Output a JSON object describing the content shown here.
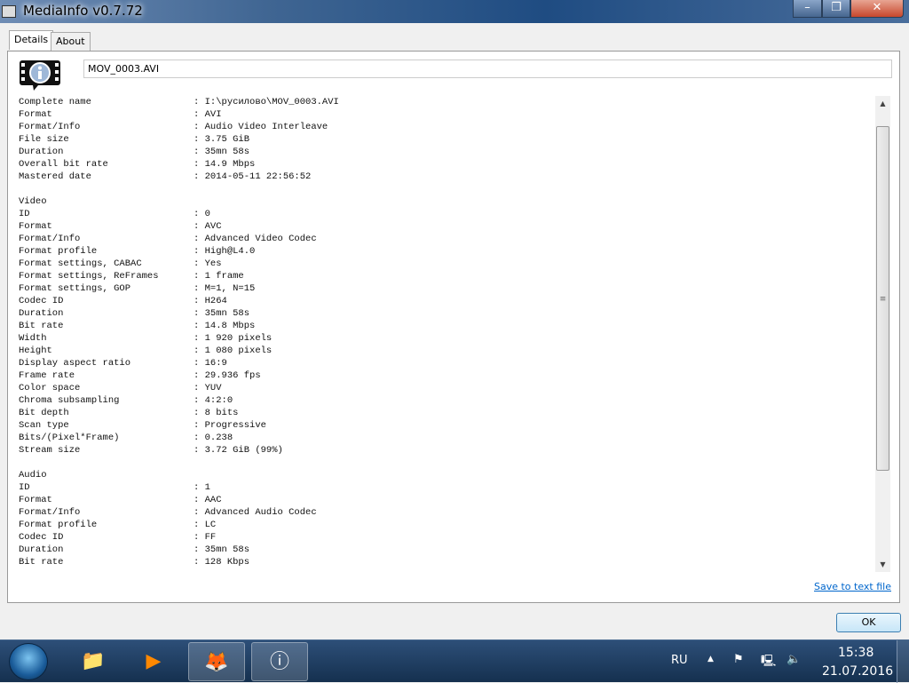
{
  "window": {
    "title": "MediaInfo v0.7.72",
    "minimize": "–",
    "maximize": "❐",
    "close": "✕"
  },
  "tabs": [
    {
      "label": "Details",
      "active": true
    },
    {
      "label": "About",
      "active": false
    }
  ],
  "file_name": "MOV_0003.AVI",
  "sections": [
    {
      "title": "",
      "rows": [
        [
          "Complete name",
          "I:\\русилово\\MOV_0003.AVI"
        ],
        [
          "Format",
          "AVI"
        ],
        [
          "Format/Info",
          "Audio Video Interleave"
        ],
        [
          "File size",
          "3.75 GiB"
        ],
        [
          "Duration",
          "35mn 58s"
        ],
        [
          "Overall bit rate",
          "14.9 Mbps"
        ],
        [
          "Mastered date",
          "2014-05-11 22:56:52"
        ]
      ]
    },
    {
      "title": "Video",
      "rows": [
        [
          "ID",
          "0"
        ],
        [
          "Format",
          "AVC"
        ],
        [
          "Format/Info",
          "Advanced Video Codec"
        ],
        [
          "Format profile",
          "High@L4.0"
        ],
        [
          "Format settings, CABAC",
          "Yes"
        ],
        [
          "Format settings, ReFrames",
          "1 frame"
        ],
        [
          "Format settings, GOP",
          "M=1, N=15"
        ],
        [
          "Codec ID",
          "H264"
        ],
        [
          "Duration",
          "35mn 58s"
        ],
        [
          "Bit rate",
          "14.8 Mbps"
        ],
        [
          "Width",
          "1 920 pixels"
        ],
        [
          "Height",
          "1 080 pixels"
        ],
        [
          "Display aspect ratio",
          "16:9"
        ],
        [
          "Frame rate",
          "29.936 fps"
        ],
        [
          "Color space",
          "YUV"
        ],
        [
          "Chroma subsampling",
          "4:2:0"
        ],
        [
          "Bit depth",
          "8 bits"
        ],
        [
          "Scan type",
          "Progressive"
        ],
        [
          "Bits/(Pixel*Frame)",
          "0.238"
        ],
        [
          "Stream size",
          "3.72 GiB (99%)"
        ]
      ]
    },
    {
      "title": "Audio",
      "rows": [
        [
          "ID",
          "1"
        ],
        [
          "Format",
          "AAC"
        ],
        [
          "Format/Info",
          "Advanced Audio Codec"
        ],
        [
          "Format profile",
          "LC"
        ],
        [
          "Codec ID",
          "FF"
        ],
        [
          "Duration",
          "35mn 58s"
        ],
        [
          "Bit rate",
          "128 Kbps"
        ]
      ]
    }
  ],
  "save_link": "Save to text file",
  "ok_button": "OK",
  "taskbar": {
    "language": "RU",
    "time": "15:38",
    "date": "21.07.2016",
    "apps": [
      {
        "name": "windows-explorer",
        "icon": "📁"
      },
      {
        "name": "media-player",
        "icon": "▶"
      },
      {
        "name": "firefox",
        "icon": "🦊"
      },
      {
        "name": "mediainfo",
        "icon": "ⓘ"
      }
    ]
  }
}
